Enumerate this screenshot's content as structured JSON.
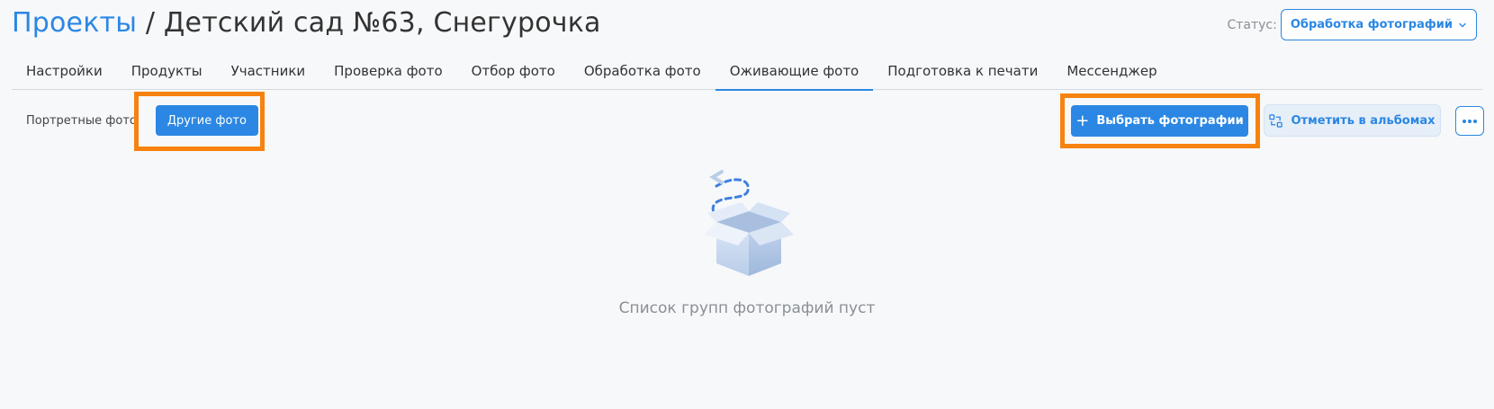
{
  "header": {
    "breadcrumb_root": "Проекты",
    "separator": "/",
    "project_name": "Детский сад №63, Снегурочка",
    "status_label": "Статус:",
    "status_value": "Обработка фотографий"
  },
  "tabs": [
    {
      "label": "Настройки",
      "active": false
    },
    {
      "label": "Продукты",
      "active": false
    },
    {
      "label": "Участники",
      "active": false
    },
    {
      "label": "Проверка фото",
      "active": false
    },
    {
      "label": "Отбор фото",
      "active": false
    },
    {
      "label": "Обработка фото",
      "active": false
    },
    {
      "label": "Оживающие фото",
      "active": true
    },
    {
      "label": "Подготовка к печати",
      "active": false
    },
    {
      "label": "Мессенджер",
      "active": false
    }
  ],
  "toolbar": {
    "portrait_label": "Портретные фото",
    "other_photos": "Другие фото",
    "choose_plus": "+",
    "choose_photos": "Выбрать фотографии",
    "mark_in_albums": "Отметить в альбомах",
    "more_icon": "ellipsis-icon"
  },
  "empty_state": {
    "icon": "open-box-icon",
    "text": "Список групп фотографий пуст"
  },
  "colors": {
    "accent": "#2b87e3",
    "highlight": "#f7820f",
    "background": "#f7f8fa"
  }
}
